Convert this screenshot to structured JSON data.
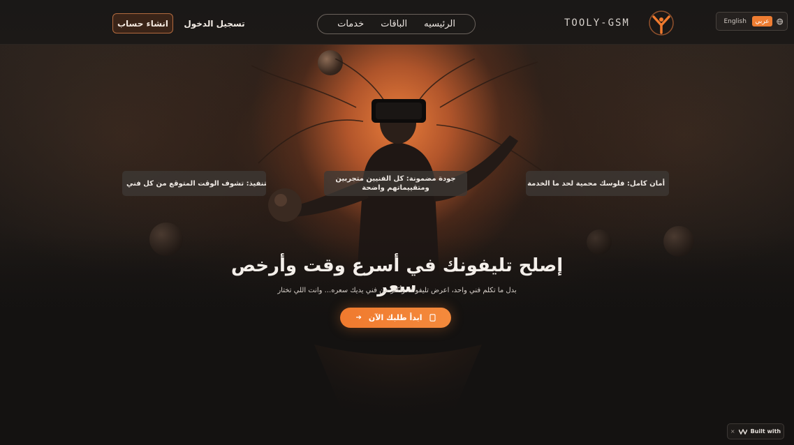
{
  "header": {
    "signup_label": "انشاء حساب",
    "login_label": "تسجيل الدخول",
    "nav": [
      {
        "label": "الرئيسيه"
      },
      {
        "label": "الباقات"
      },
      {
        "label": "خدمات"
      }
    ],
    "brand_name": "TOOLY-GSM",
    "lang": {
      "english": "English",
      "arabic": "عربي",
      "icon": "globe-icon"
    }
  },
  "hero": {
    "cards": {
      "speed": "سرعة في التنفيذ: تشوف الوقت المتوقع من كل فني",
      "quality": "جودة مضمونة: كل الفنيين متجربين ومتقييماتهم واضحة",
      "safety": "أمان كامل: فلوسك محمية لحد ما الخدمة تتم"
    },
    "title": "إصلح تليفونك في أسرع وقت وأرخص سعر",
    "subtitle": "بدل ما تكلم فني واحد، اعرض تليفونك وأكتر من فني يديك سعره... وانت اللي تختار",
    "cta_label": "ابدأ طلبك الآن",
    "cta_icon": "phone-icon"
  },
  "badge": {
    "close": "×",
    "label": "Built with",
    "icon": "logo-icon"
  },
  "colors": {
    "accent": "#ef7d32",
    "background": "#151312"
  }
}
